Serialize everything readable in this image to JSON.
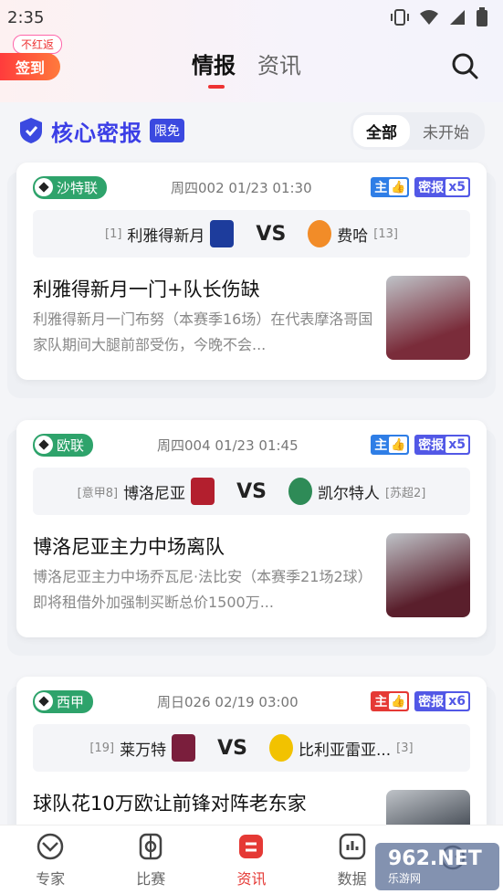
{
  "status_bar": {
    "time": "2:35"
  },
  "header": {
    "signin_tag": "不红返",
    "signin_label": "签到",
    "tabs": [
      {
        "label": "情报",
        "active": true
      },
      {
        "label": "资讯",
        "active": false
      }
    ]
  },
  "section": {
    "title": "核心密报",
    "badge": "限免",
    "filters": [
      {
        "label": "全部",
        "active": true
      },
      {
        "label": "未开始",
        "active": false
      }
    ]
  },
  "cards": [
    {
      "league": "沙特联",
      "time": "周四002 01/23 01:30",
      "zhu_label": "主",
      "zhu_color": "#2f7ee6",
      "mibao_label": "密报",
      "mibao_count": "x5",
      "home_rank": "[1]",
      "home_team": "利雅得新月",
      "home_color": "#1d3c9c",
      "vs": "VS",
      "away_team": "费哈",
      "away_rank": "[13]",
      "away_color": "#f28c28",
      "title": "利雅得新月一门+队长伤缺",
      "desc": "利雅得新月一门布努（本赛季16场）在代表摩洛哥国家队期间大腿前部受伤，今晚不会...",
      "img_color": "#7a2c3a"
    },
    {
      "league": "欧联",
      "time": "周四004 01/23 01:45",
      "zhu_label": "主",
      "zhu_color": "#2f7ee6",
      "mibao_label": "密报",
      "mibao_count": "x5",
      "home_rank": "[意甲8]",
      "home_team": "博洛尼亚",
      "home_color": "#b31f2e",
      "vs": "VS",
      "away_team": "凯尔特人",
      "away_rank": "[苏超2]",
      "away_color": "#2e8b57",
      "title": "博洛尼亚主力中场离队",
      "desc": "博洛尼亚主力中场乔瓦尼·法比安（本赛季21场2球）即将租借外加强制买断总价1500万...",
      "img_color": "#5a1f2c"
    },
    {
      "league": "西甲",
      "time": "周日026 02/19 03:00",
      "zhu_label": "主",
      "zhu_color": "#e53935",
      "mibao_label": "密报",
      "mibao_count": "x6",
      "home_rank": "[19]",
      "home_team": "莱万特",
      "home_color": "#7a1e3c",
      "vs": "VS",
      "away_team": "比利亚雷亚...",
      "away_rank": "[3]",
      "away_color": "#f2c200",
      "title": "球队花10万欧让前锋对阵老东家",
      "desc": "",
      "img_color": "#333a44"
    }
  ],
  "bottom_nav": [
    {
      "label": "专家",
      "icon": "expert-icon",
      "active": false
    },
    {
      "label": "比赛",
      "icon": "match-icon",
      "active": false
    },
    {
      "label": "资讯",
      "icon": "news-icon",
      "active": true
    },
    {
      "label": "数据",
      "icon": "data-icon",
      "active": false
    },
    {
      "label": "",
      "icon": "profile-icon",
      "active": false
    }
  ],
  "watermark": {
    "line1": "962.NET",
    "line2": "乐游网"
  }
}
